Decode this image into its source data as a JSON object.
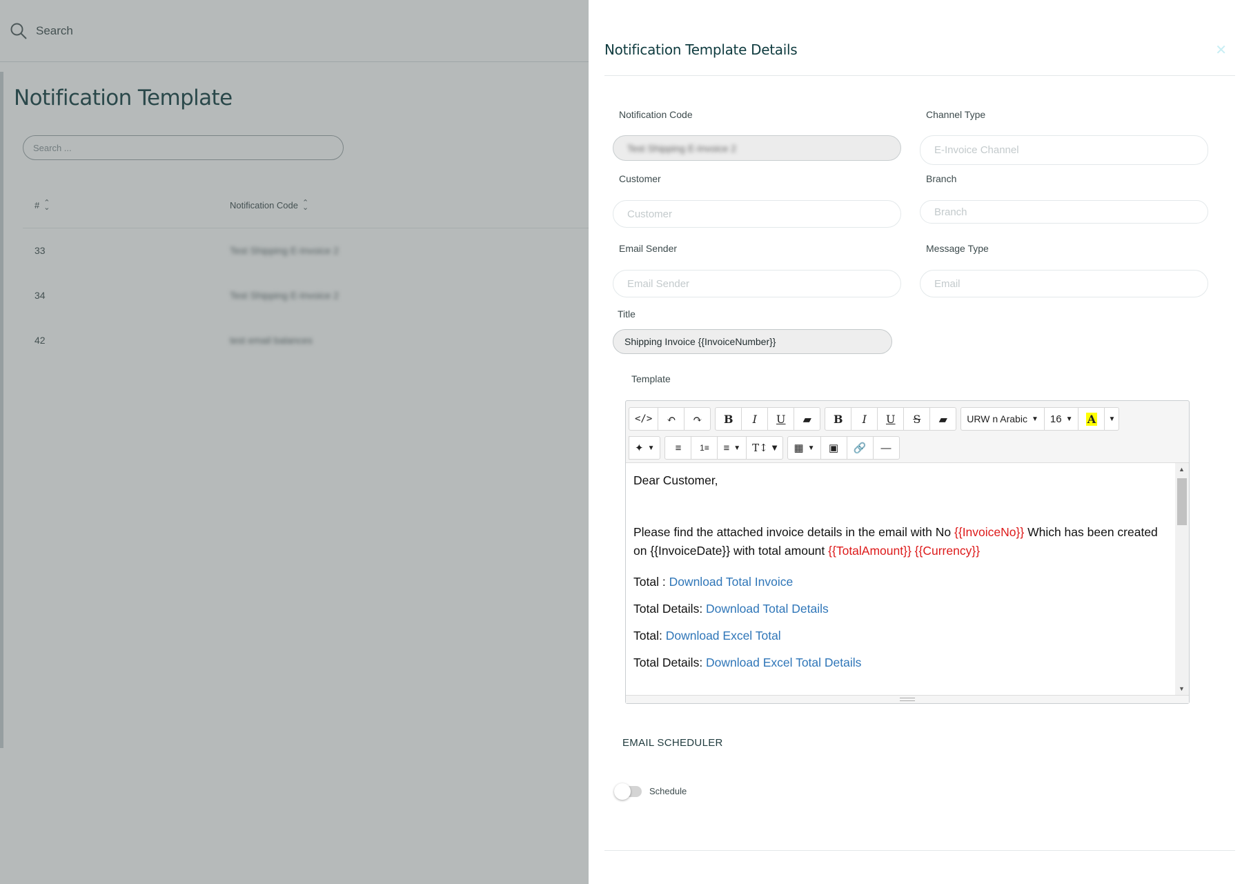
{
  "background": {
    "search_label": "Search",
    "page_title": "Notification Template",
    "search_placeholder": "Search ...",
    "table": {
      "headers": [
        "#",
        "Notification Code"
      ],
      "rows": [
        {
          "num": "33",
          "code": "Test Shipping E-Invoice 2"
        },
        {
          "num": "34",
          "code": "Test Shipping E-Invoice 2"
        },
        {
          "num": "42",
          "code": "test email balances"
        }
      ]
    }
  },
  "drawer": {
    "title": "Notification Template Details",
    "close_icon": "close-icon",
    "fields": {
      "notification_code": {
        "label": "Notification Code",
        "value": "Test Shipping E-Invoice 2"
      },
      "channel_type": {
        "label": "Channel Type",
        "placeholder": "E-Invoice Channel"
      },
      "customer": {
        "label": "Customer",
        "placeholder": "Customer"
      },
      "branch": {
        "label": "Branch",
        "placeholder": "Branch"
      },
      "email_sender": {
        "label": "Email Sender",
        "placeholder": "Email Sender"
      },
      "message_type": {
        "label": "Message Type",
        "placeholder": "Email"
      },
      "title": {
        "label": "Title",
        "value": "Shipping Invoice {{InvoiceNumber}}"
      }
    },
    "template": {
      "label": "Template",
      "toolbar": {
        "font_name": "URW n Arabic",
        "font_size": "16"
      },
      "content": {
        "greeting": "Dear Customer,",
        "p1_a": "Please find the attached invoice details in the email with No ",
        "p1_invoice_no": "{{InvoiceNo}}",
        "p1_b": " Which has been created on {{InvoiceDate}} with total amount ",
        "p1_total": "{{TotalAmount}}",
        "p1_sp": " ",
        "p1_currency": "{{Currency}}",
        "l1_label": "Total : ",
        "l1_link": "Download Total Invoice",
        "l2_label": "Total Details: ",
        "l2_link": "Download Total Details",
        "l3_label": "Total: ",
        "l3_link": "Download Excel Total",
        "l4_label": "Total Details: ",
        "l4_link": "Download Excel Total Details"
      }
    },
    "scheduler": {
      "heading": "EMAIL SCHEDULER",
      "toggle_label": "Schedule",
      "enabled": false
    }
  },
  "colors": {
    "accent_dark": "#0f3b3f",
    "placeholder_red": "#dd1a1a",
    "link_blue": "#2f76b8",
    "overlay": "#8c9596"
  }
}
